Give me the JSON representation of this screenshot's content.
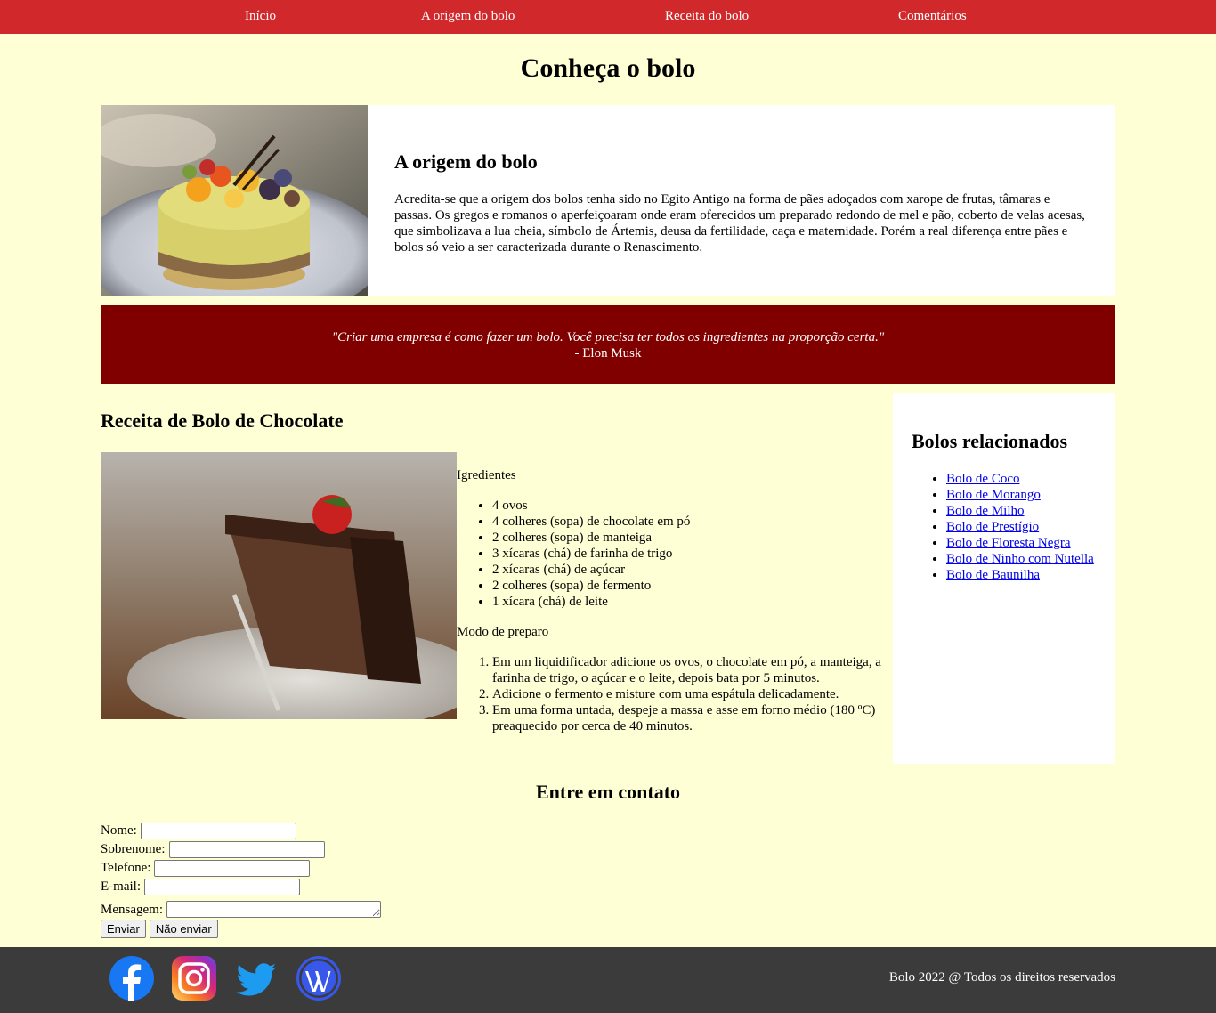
{
  "nav": {
    "items": [
      "Início",
      "A origem do bolo",
      "Receita do bolo",
      "Comentários"
    ]
  },
  "page_title": "Conheça o bolo",
  "origin": {
    "title": "A origem do bolo",
    "text": "Acredita-se que a origem dos bolos tenha sido no Egito Antigo na forma de pães adoçados com xarope de frutas, tâmaras e passas. Os gregos e romanos o aperfeiçoaram onde eram oferecidos um preparado redondo de mel e pão, coberto de velas acesas, que simbolizava a lua cheia, símbolo de Ártemis, deusa da fertilidade, caça e maternidade. Porém a real diferença entre pães e bolos só veio a ser caracterizada durante o Renascimento."
  },
  "quote": {
    "text": "\"Criar uma empresa é como fazer um bolo. Você precisa ter todos os ingredientes na proporção certa.\"",
    "author": "- Elon Musk"
  },
  "recipe": {
    "title": "Receita de Bolo de Chocolate",
    "ingredients_label": "Igredientes",
    "ingredients": [
      "4 ovos",
      "4 colheres (sopa) de chocolate em pó",
      "2 colheres (sopa) de manteiga",
      "3 xícaras (chá) de farinha de trigo",
      "2 xícaras (chá) de açúcar",
      "2 colheres (sopa) de fermento",
      "1 xícara (chá) de leite"
    ],
    "method_label": "Modo de preparo",
    "steps": [
      "Em um liquidificador adicione os ovos, o chocolate em pó, a manteiga, a farinha de trigo, o açúcar e o leite, depois bata por 5 minutos.",
      "Adicione o fermento e misture com uma espátula delicadamente.",
      "Em uma forma untada, despeje a massa e asse em forno médio (180 ºC) preaquecido por cerca de 40 minutos."
    ]
  },
  "sidebar": {
    "title": "Bolos relacionados",
    "links": [
      "Bolo de Coco",
      "Bolo de Morango",
      "Bolo de Milho",
      "Bolo de Prestígio",
      "Bolo de Floresta Negra",
      "Bolo de Ninho com Nutella",
      "Bolo de Baunilha"
    ]
  },
  "contact": {
    "title": "Entre em contato",
    "fields": {
      "nome": {
        "label": "Nome:",
        "value": ""
      },
      "sobrenome": {
        "label": "Sobrenome:",
        "value": ""
      },
      "telefone": {
        "label": "Telefone:",
        "value": ""
      },
      "email": {
        "label": "E-mail:",
        "value": ""
      },
      "mensagem": {
        "label": "Mensagem:",
        "value": ""
      }
    },
    "submit_label": "Enviar",
    "reset_label": "Não enviar"
  },
  "footer": {
    "copyright": "Bolo 2022 @ Todos os direitos reservados",
    "social_icons": [
      "facebook-icon",
      "instagram-icon",
      "twitter-icon",
      "wordpress-icon"
    ]
  },
  "colors": {
    "nav_bg": "#d1292b",
    "page_bg": "#ffffd6",
    "quote_bg": "#800000",
    "footer_bg": "#3b3b3b",
    "link": "#0000ee"
  }
}
